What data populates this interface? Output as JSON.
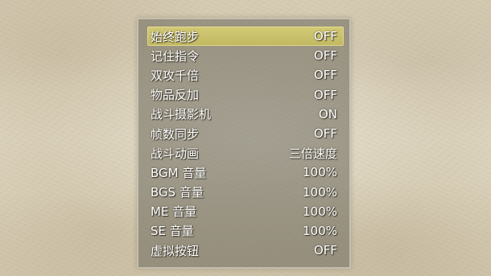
{
  "options": [
    {
      "label": "始终跑步",
      "value": "OFF",
      "selected": true
    },
    {
      "label": "记住指令",
      "value": "OFF",
      "selected": false
    },
    {
      "label": "双攻千倍",
      "value": "OFF",
      "selected": false
    },
    {
      "label": "物品反加",
      "value": "OFF",
      "selected": false
    },
    {
      "label": "战斗摄影机",
      "value": "ON",
      "selected": false
    },
    {
      "label": "帧数同步",
      "value": "OFF",
      "selected": false
    },
    {
      "label": "战斗动画",
      "value": "三倍速度",
      "selected": false
    },
    {
      "label": "BGM 音量",
      "value": "100%",
      "selected": false
    },
    {
      "label": "BGS 音量",
      "value": "100%",
      "selected": false
    },
    {
      "label": "ME 音量",
      "value": "100%",
      "selected": false
    },
    {
      "label": "SE 音量",
      "value": "100%",
      "selected": false
    },
    {
      "label": "虚拟按钮",
      "value": "OFF",
      "selected": false
    }
  ],
  "colors": {
    "highlight": "#d0c66e",
    "window": "#706c60",
    "text": "#ffffff"
  }
}
